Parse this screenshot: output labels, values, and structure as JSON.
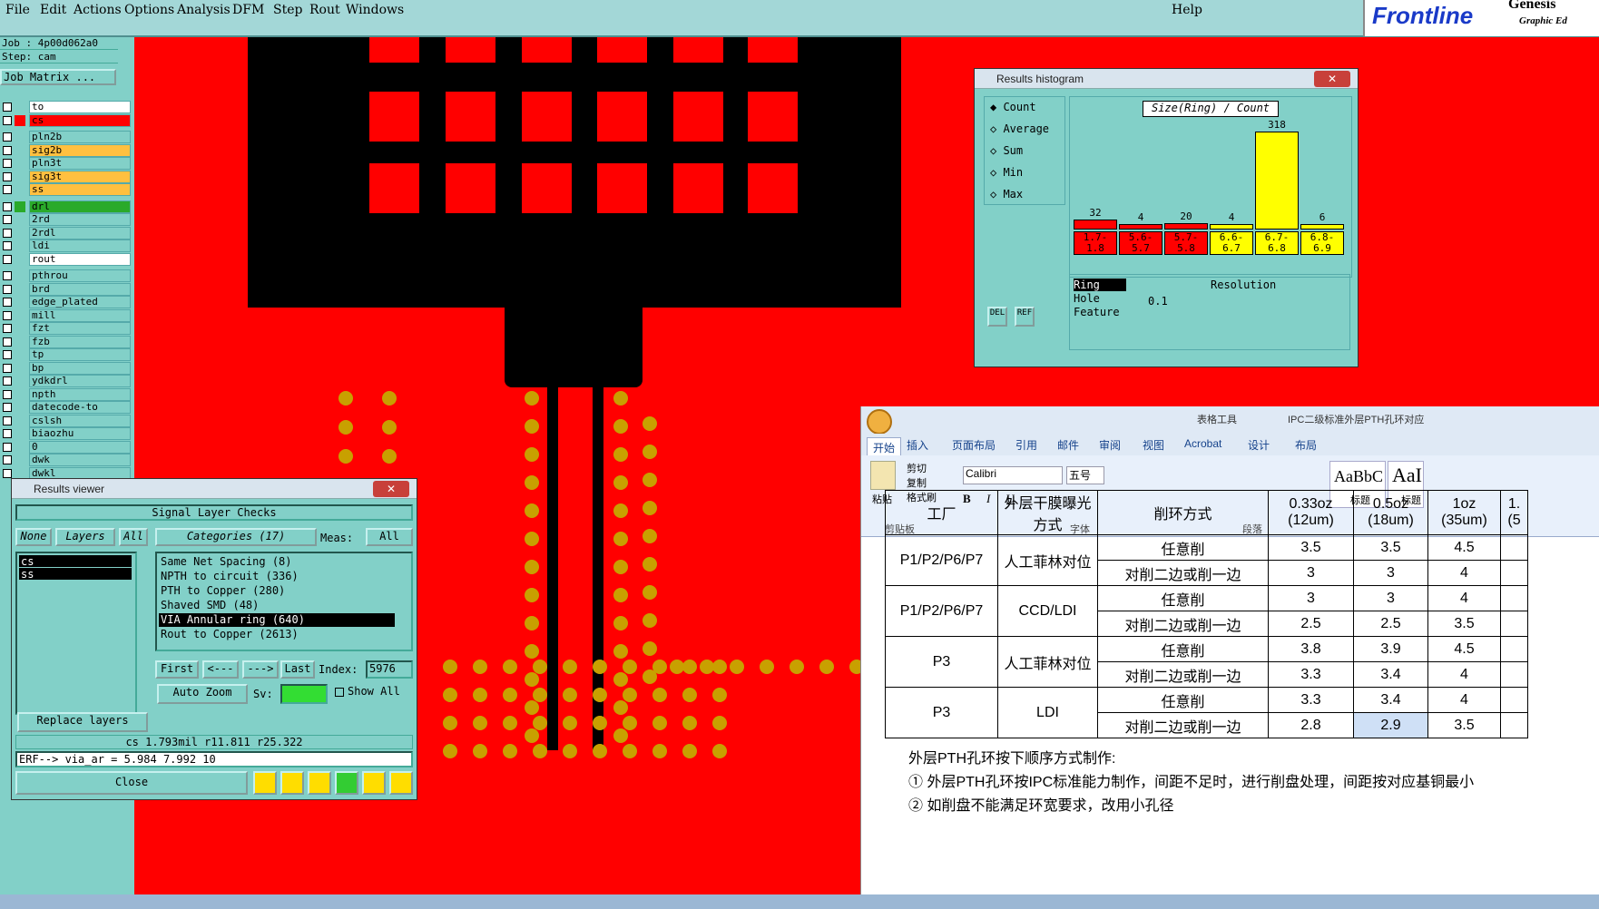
{
  "menu": {
    "items": [
      "File",
      "Edit",
      "Actions",
      "Options",
      "Analysis",
      "DFM",
      "Step",
      "Rout",
      "Windows"
    ],
    "help": "Help"
  },
  "logo": {
    "brand": "Frontline",
    "product": "Genesis",
    "sub": "Graphic Ed"
  },
  "job": {
    "job_line": "Job : 4p00d062a0",
    "step_line": "Step: cam",
    "matrix_button": "Job Matrix ..."
  },
  "layers": [
    {
      "name": "to",
      "color": "#ffffff"
    },
    {
      "name": "cs",
      "color": "#ff0000"
    },
    {
      "name": "pln2b",
      "color": ""
    },
    {
      "name": "sig2b",
      "color": "#ffc040"
    },
    {
      "name": "pln3t",
      "color": ""
    },
    {
      "name": "sig3t",
      "color": "#ffc040"
    },
    {
      "name": "ss",
      "color": "#ffc040"
    },
    {
      "name": "drl",
      "color": "#2aaa2a"
    },
    {
      "name": "2rd",
      "color": ""
    },
    {
      "name": "2rdl",
      "color": ""
    },
    {
      "name": "ldi",
      "color": ""
    },
    {
      "name": "rout",
      "color": "#ffffff"
    },
    {
      "name": "pthrou",
      "color": ""
    },
    {
      "name": "brd",
      "color": ""
    },
    {
      "name": "edge_plated",
      "color": ""
    },
    {
      "name": "mill",
      "color": ""
    },
    {
      "name": "fzt",
      "color": ""
    },
    {
      "name": "fzb",
      "color": ""
    },
    {
      "name": "tp",
      "color": ""
    },
    {
      "name": "bp",
      "color": ""
    },
    {
      "name": "ydkdrl",
      "color": ""
    },
    {
      "name": "npth",
      "color": ""
    },
    {
      "name": "datecode-to",
      "color": ""
    },
    {
      "name": "cslsh",
      "color": ""
    },
    {
      "name": "biaozhu",
      "color": ""
    },
    {
      "name": "0",
      "color": ""
    },
    {
      "name": "dwk",
      "color": ""
    },
    {
      "name": "dwkl",
      "color": ""
    }
  ],
  "histogram": {
    "title": "Results histogram",
    "options": [
      "Count",
      "Average",
      "Sum",
      "Min",
      "Max"
    ],
    "selected": "Count",
    "chart_title": "Size(Ring) / Count",
    "bins": [
      {
        "range": "1.7-1.8",
        "count": "32",
        "color": "#ff0000"
      },
      {
        "range": "5.6-5.7",
        "count": "4",
        "color": "#ff0000"
      },
      {
        "range": "5.7-5.8",
        "count": "20",
        "color": "#ff0000"
      },
      {
        "range": "6.6-6.7",
        "count": "4",
        "color": "#ffff00"
      },
      {
        "range": "6.7-6.8",
        "count": "318",
        "color": "#ffff00"
      },
      {
        "range": "6.8-6.9",
        "count": "6",
        "color": "#ffff00"
      }
    ],
    "types": [
      "Ring",
      "Hole",
      "Feature"
    ],
    "resolution_label": "Resolution",
    "resolution_value": "0.1",
    "btn_del": "DEL",
    "btn_ref": "REF"
  },
  "results": {
    "title": "Results viewer",
    "header": "Signal Layer Checks",
    "none": "None",
    "layers": "Layers",
    "all": "All",
    "categories": "Categories (17)",
    "meas_label": "Meas:",
    "meas_value": "All",
    "layer_list": [
      "cs",
      "ss"
    ],
    "category_list": [
      "Same Net Spacing (8)",
      "NPTH to circuit (336)",
      "PTH to Copper (280)",
      "Shaved SMD (48)",
      "VIA Annular ring (640)",
      "Rout to Copper (2613)"
    ],
    "first": "First",
    "prev": "<---",
    "next": "--->",
    "last": "Last",
    "index_label": "Index:",
    "index_value": "5976",
    "auto_zoom": "Auto Zoom",
    "sv": "Sv:",
    "show_all": "Show All",
    "replace_layers": "Replace layers",
    "status": "cs 1.793mil  r11.811  r25.322",
    "erf": "ERF--> via_ar = 5.984 7.992 10",
    "close": "Close"
  },
  "word": {
    "title": "IPC二级标准外层PTH孔环对应",
    "tools": "表格工具",
    "tabs": [
      "开始",
      "插入",
      "页面布局",
      "引用",
      "邮件",
      "审阅",
      "视图",
      "Acrobat",
      "设计",
      "布局"
    ],
    "clipboard": [
      "剪切",
      "复制",
      "格式刷"
    ],
    "paste": "粘贴",
    "font": "Calibri",
    "size": "五号",
    "groups": [
      "剪贴板",
      "字体",
      "段落"
    ],
    "style1": "AaBbC",
    "style1_label": "标题",
    "style2": "AaI",
    "style2_label": "标题",
    "table": {
      "header": [
        "工厂",
        "外层干膜曝光方式",
        "削环方式",
        "0.33oz (12um)",
        "0.5oz (18um)",
        "1oz (35um)",
        "1. (5"
      ],
      "rows": [
        [
          "P1/P2/P6/P7",
          "人工菲林对位",
          "任意削",
          "3.5",
          "3.5",
          "4.5"
        ],
        [
          "",
          "",
          "对削二边或削一边",
          "3",
          "3",
          "4"
        ],
        [
          "P1/P2/P6/P7",
          "CCD/LDI",
          "任意削",
          "3",
          "3",
          "4"
        ],
        [
          "",
          "",
          "对削二边或削一边",
          "2.5",
          "2.5",
          "3.5"
        ],
        [
          "P3",
          "人工菲林对位",
          "任意削",
          "3.8",
          "3.9",
          "4.5"
        ],
        [
          "",
          "",
          "对削二边或削一边",
          "3.3",
          "3.4",
          "4"
        ],
        [
          "P3",
          "LDI",
          "任意削",
          "3.3",
          "3.4",
          "4"
        ],
        [
          "",
          "",
          "对削二边或削一边",
          "2.8",
          "2.9",
          "3.5"
        ]
      ]
    },
    "para1": "外层PTH孔环按下顺序方式制作:",
    "para2": "① 外层PTH孔环按IPC标准能力制作，间距不足时，进行削盘处理，间距按对应基铜最小",
    "para3": "② 如削盘不能满足环宽要求，改用小孔径"
  }
}
